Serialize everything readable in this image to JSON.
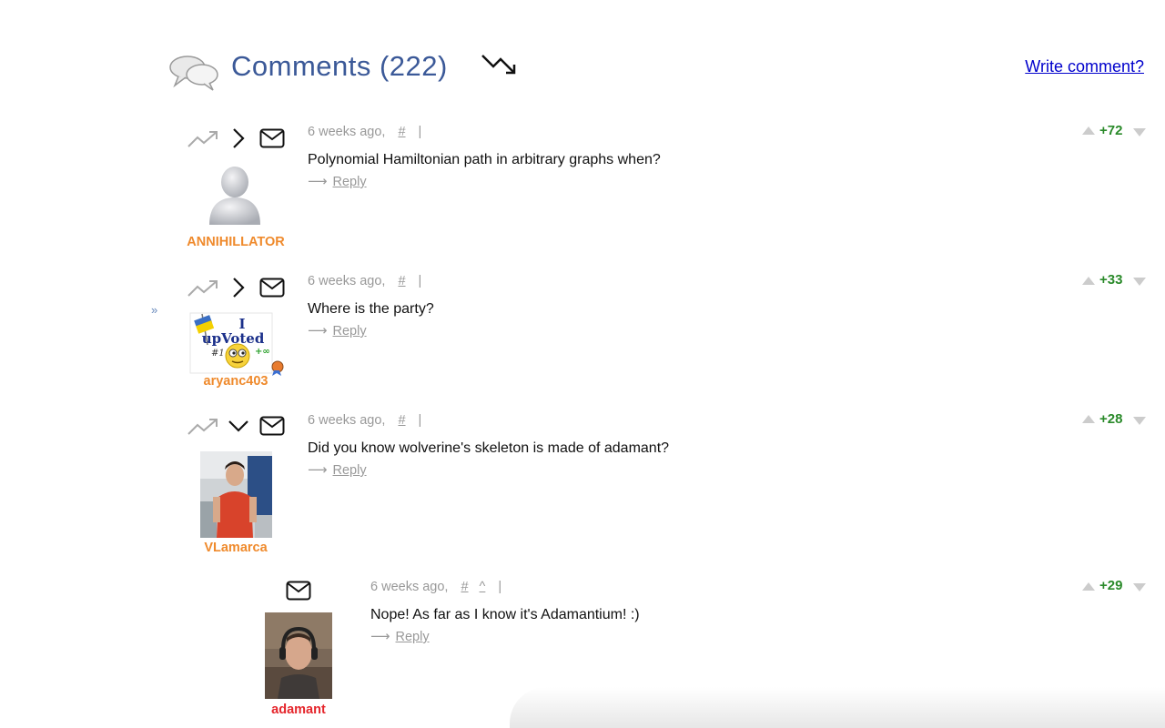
{
  "header": {
    "title": "Comments (222)",
    "write_comment": "Write comment?"
  },
  "comments": [
    {
      "time": "6 weeks ago,",
      "hash": "#",
      "pipe": "|",
      "text": "Polynomial Hamiltonian path in arbitrary graphs when?",
      "reply_arrow": "⟶",
      "reply": "Reply",
      "author": "ANNIHILLATOR",
      "votes": "+72"
    },
    {
      "time": "6 weeks ago,",
      "hash": "#",
      "pipe": "|",
      "text": "Where is the party?",
      "reply_arrow": "⟶",
      "reply": "Reply",
      "author": "aryanc403",
      "votes": "+33",
      "avatar_text": {
        "line1": "I",
        "line2": "upVoted",
        "left": "#1",
        "right": "+∞"
      }
    },
    {
      "time": "6 weeks ago,",
      "hash": "#",
      "pipe": "|",
      "text": "Did you know wolverine's skeleton is made of adamant?",
      "reply_arrow": "⟶",
      "reply": "Reply",
      "author": "VLamarca",
      "votes": "+28"
    },
    {
      "time": "6 weeks ago,",
      "hash": "#",
      "up": "^",
      "pipe": "|",
      "text": "Nope! As far as I know it's Adamantium! :)",
      "reply_arrow": "⟶",
      "reply": "Reply",
      "author": "adamant",
      "votes": "+29"
    }
  ],
  "nest_marker": "»",
  "colors": {
    "title_blue": "#3b5998",
    "link_blue": "#0000cc",
    "username_orange": "#ef8a2c",
    "username_red": "#e5262c",
    "vote_green": "#2a8a2a",
    "meta_gray": "#999999"
  },
  "icons": [
    "comments-icon",
    "sort-down-icon",
    "trend-icon",
    "chevron-right-icon",
    "chevron-down-icon",
    "mail-icon",
    "vote-up-icon",
    "vote-down-icon"
  ]
}
